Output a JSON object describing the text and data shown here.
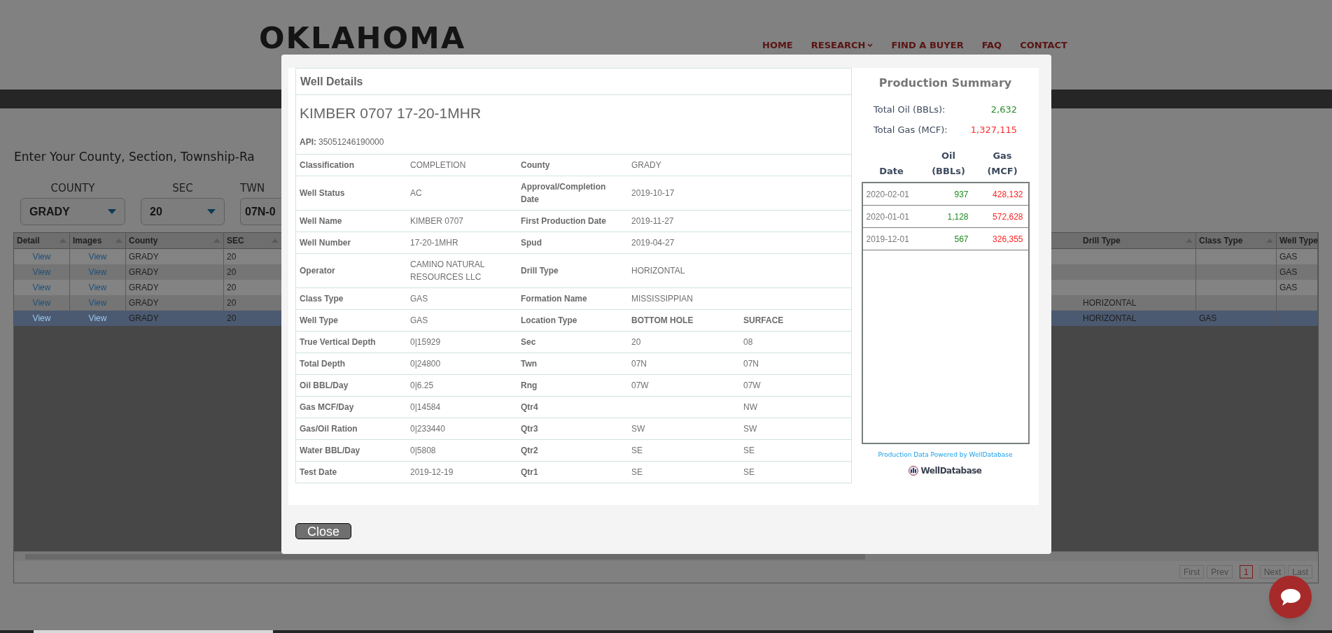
{
  "header": {
    "logo": "OKLAHOMA",
    "nav": [
      {
        "label": "HOME",
        "dropdown": false
      },
      {
        "label": "RESEARCH",
        "dropdown": true
      },
      {
        "label": "FIND A BUYER",
        "dropdown": false
      },
      {
        "label": "FAQ",
        "dropdown": false
      },
      {
        "label": "CONTACT",
        "dropdown": false
      }
    ]
  },
  "search": {
    "heading": "Enter Your County, Section, Township-Ra",
    "filters": [
      {
        "label": "COUNTY",
        "value": "GRADY",
        "caret": true
      },
      {
        "label": "SEC",
        "value": "20",
        "caret": true
      },
      {
        "label": "TWN",
        "value": "07N-0",
        "caret": false
      }
    ]
  },
  "table": {
    "columns": [
      {
        "label": "Detail",
        "kind": "link"
      },
      {
        "label": "Images",
        "kind": "link"
      },
      {
        "label": "County",
        "kind": "text"
      },
      {
        "label": "SEC",
        "kind": "text"
      },
      {
        "label": "Drill Type",
        "kind": "text"
      },
      {
        "label": "Class Type",
        "kind": "text"
      },
      {
        "label": "Well Type",
        "kind": "text"
      }
    ],
    "rows": [
      {
        "cells": [
          "View",
          "View",
          "GRADY",
          "20",
          null,
          null,
          "GAS"
        ],
        "selected": false
      },
      {
        "cells": [
          "View",
          "View",
          "GRADY",
          "20",
          null,
          null,
          "GAS"
        ],
        "selected": false
      },
      {
        "cells": [
          "View",
          "View",
          "GRADY",
          "20",
          null,
          null,
          "GAS"
        ],
        "selected": false
      },
      {
        "cells": [
          "View",
          "View",
          "GRADY",
          "20",
          "HORIZONTAL",
          null,
          null
        ],
        "selected": false
      },
      {
        "cells": [
          "View",
          "View",
          "GRADY",
          "20",
          "HORIZONTAL",
          "GAS",
          null
        ],
        "selected": true
      }
    ],
    "pager": [
      {
        "label": "First",
        "selected": false
      },
      {
        "label": "Prev",
        "selected": false
      },
      {
        "label": "1",
        "selected": true
      },
      {
        "label": "Next",
        "selected": false
      },
      {
        "label": "Last",
        "selected": false
      }
    ]
  },
  "modal": {
    "details": {
      "title": "Well Details",
      "well_name": "KIMBER 0707 17-20-1MHR",
      "api_label": "API:",
      "api": "35051246190000",
      "rows": [
        [
          {
            "kind": "label",
            "text": "Classification"
          },
          {
            "kind": "value",
            "text": "COMPLETION"
          },
          {
            "kind": "label",
            "text": "County"
          },
          {
            "kind": "value",
            "text": "GRADY"
          }
        ],
        [
          {
            "kind": "label",
            "text": "Well Status"
          },
          {
            "kind": "value",
            "text": "AC"
          },
          {
            "kind": "label",
            "text": "Approval/Completion Date"
          },
          {
            "kind": "value",
            "text": "2019-10-17"
          }
        ],
        [
          {
            "kind": "label",
            "text": "Well Name"
          },
          {
            "kind": "value",
            "text": "KIMBER 0707"
          },
          {
            "kind": "label",
            "text": "First Production Date"
          },
          {
            "kind": "value",
            "text": "2019-11-27"
          }
        ],
        [
          {
            "kind": "label",
            "text": "Well Number"
          },
          {
            "kind": "value",
            "text": "17-20-1MHR"
          },
          {
            "kind": "label",
            "text": "Spud"
          },
          {
            "kind": "value",
            "text": "2019-04-27"
          }
        ],
        [
          {
            "kind": "label",
            "text": "Operator"
          },
          {
            "kind": "value",
            "text": "CAMINO NATURAL RESOURCES LLC"
          },
          {
            "kind": "label",
            "text": "Drill Type"
          },
          {
            "kind": "value",
            "text": "HORIZONTAL"
          }
        ],
        [
          {
            "kind": "label",
            "text": "Class Type"
          },
          {
            "kind": "value",
            "text": "GAS"
          },
          {
            "kind": "label",
            "text": "Formation Name"
          },
          {
            "kind": "value",
            "text": "MISSISSIPPIAN"
          }
        ],
        [
          {
            "kind": "label",
            "text": "Well Type"
          },
          {
            "kind": "value",
            "text": "GAS"
          },
          {
            "kind": "label",
            "text": "Location Type"
          },
          {
            "kind": "heading",
            "text": "BOTTOM HOLE"
          },
          {
            "kind": "heading",
            "text": "SURFACE"
          }
        ],
        [
          {
            "kind": "label",
            "text": "True Vertical Depth"
          },
          {
            "kind": "value",
            "text": "0|15929"
          },
          {
            "kind": "label",
            "text": "Sec"
          },
          {
            "kind": "value",
            "text": "20"
          },
          {
            "kind": "value",
            "text": "08"
          }
        ],
        [
          {
            "kind": "label",
            "text": "Total Depth"
          },
          {
            "kind": "value",
            "text": "0|24800"
          },
          {
            "kind": "label",
            "text": "Twn"
          },
          {
            "kind": "value",
            "text": "07N"
          },
          {
            "kind": "value",
            "text": "07N"
          }
        ],
        [
          {
            "kind": "label",
            "text": "Oil BBL/Day"
          },
          {
            "kind": "value",
            "text": "0|6.25"
          },
          {
            "kind": "label",
            "text": "Rng"
          },
          {
            "kind": "value",
            "text": "07W"
          },
          {
            "kind": "value",
            "text": "07W"
          }
        ],
        [
          {
            "kind": "label",
            "text": "Gas MCF/Day"
          },
          {
            "kind": "value",
            "text": "0|14584"
          },
          {
            "kind": "label",
            "text": "Qtr4"
          },
          {
            "kind": "blank",
            "text": ""
          },
          {
            "kind": "value",
            "text": "NW"
          }
        ],
        [
          {
            "kind": "label",
            "text": "Gas/Oil Ration"
          },
          {
            "kind": "value",
            "text": "0|233440"
          },
          {
            "kind": "label",
            "text": "Qtr3"
          },
          {
            "kind": "value",
            "text": "SW"
          },
          {
            "kind": "value",
            "text": "SW"
          }
        ],
        [
          {
            "kind": "label",
            "text": "Water BBL/Day"
          },
          {
            "kind": "value",
            "text": "0|5808"
          },
          {
            "kind": "label",
            "text": "Qtr2"
          },
          {
            "kind": "value",
            "text": "SE"
          },
          {
            "kind": "value",
            "text": "SE"
          }
        ],
        [
          {
            "kind": "label",
            "text": "Test Date"
          },
          {
            "kind": "value",
            "text": "2019-12-19"
          },
          {
            "kind": "label",
            "text": "Qtr1"
          },
          {
            "kind": "value",
            "text": "SE"
          },
          {
            "kind": "value",
            "text": "SE"
          }
        ]
      ]
    },
    "summary": {
      "title": "Production Summary",
      "totals": [
        {
          "label": "Total Oil (BBLs):",
          "value": "2,632",
          "kind": "oil"
        },
        {
          "label": "Total Gas (MCF):",
          "value": "1,327,115",
          "kind": "gas"
        }
      ],
      "columns": [
        "Date",
        "Oil (BBLs)",
        "Gas (MCF)"
      ],
      "rows": [
        {
          "date": "2020-02-01",
          "oil": "937",
          "gas": "428,132"
        },
        {
          "date": "2020-01-01",
          "oil": "1,128",
          "gas": "572,628"
        },
        {
          "date": "2019-12-01",
          "oil": "567",
          "gas": "326,355"
        }
      ],
      "credit": "Production Data Powered by WellDatabase",
      "logo": "WellDatabase"
    },
    "close": "Close"
  }
}
